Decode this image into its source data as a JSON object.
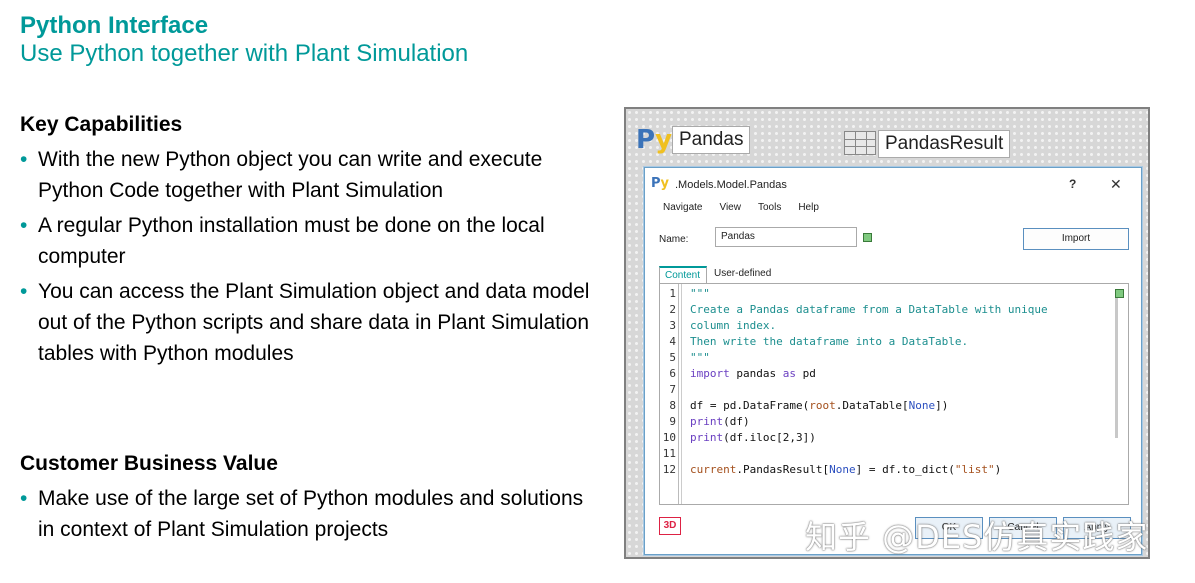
{
  "slide": {
    "title": "Python Interface",
    "subtitle": "Use Python together with Plant Simulation"
  },
  "key_capabilities": {
    "heading": "Key Capabilities",
    "bullets": [
      "With the new Python object you can write and execute  Python Code together with Plant Simulation",
      "A regular Python installation must be done on the local computer",
      "You can access the Plant Simulation object and data model out of the Python scripts and share data in Plant Simulation tables with Python modules"
    ]
  },
  "customer_value": {
    "heading": "Customer Business Value",
    "bullets": [
      "Make use of the large set of Python modules and solutions in context of Plant Simulation projects"
    ]
  },
  "screenshot": {
    "python_icon": {
      "p": "P",
      "y": "y"
    },
    "object_label_1": "Pandas",
    "object_label_2": "PandasResult",
    "dialog": {
      "icon": {
        "p": "P",
        "y": "y"
      },
      "title": ".Models.Model.Pandas",
      "help": "?",
      "close": "✕",
      "menu": [
        "Navigate",
        "View",
        "Tools",
        "Help"
      ],
      "name_label": "Name:",
      "name_value": "Pandas",
      "import_button": "Import",
      "tabs": [
        "Content",
        "User-defined"
      ],
      "code_lines": [
        {
          "n": "1",
          "t": "\"\"\""
        },
        {
          "n": "2",
          "t": "Create a Pandas dataframe from a DataTable with unique"
        },
        {
          "n": "3",
          "t": "column index."
        },
        {
          "n": "4",
          "t": "Then write the dataframe into a DataTable."
        },
        {
          "n": "5",
          "t": "\"\"\""
        },
        {
          "n": "6",
          "a": "import",
          "b": " pandas ",
          "c": "as",
          "d": " pd"
        },
        {
          "n": "7",
          "t": ""
        },
        {
          "n": "8",
          "a": "df = pd.DataFrame(",
          "b": "root",
          "c": ".DataTable[",
          "d": "None",
          "e": "])"
        },
        {
          "n": "9",
          "a": "print",
          "b": "(df)"
        },
        {
          "n": "10",
          "a": "print",
          "b": "(df.iloc[2,3])"
        },
        {
          "n": "11",
          "t": ""
        },
        {
          "n": "12",
          "a": "current",
          "b": ".PandasResult[",
          "c": "None",
          "d": "] = df.to_dict(",
          "e": "\"list\"",
          "f": ")"
        }
      ],
      "three_d_button": "3D",
      "footer_buttons": [
        "OK",
        "Cancel",
        "Apply"
      ]
    },
    "watermark": "知乎 @DES仿真实践家"
  },
  "colors": {
    "accent_teal": "#009999",
    "python_blue": "#3b73b9",
    "python_yellow": "#f0c020"
  }
}
